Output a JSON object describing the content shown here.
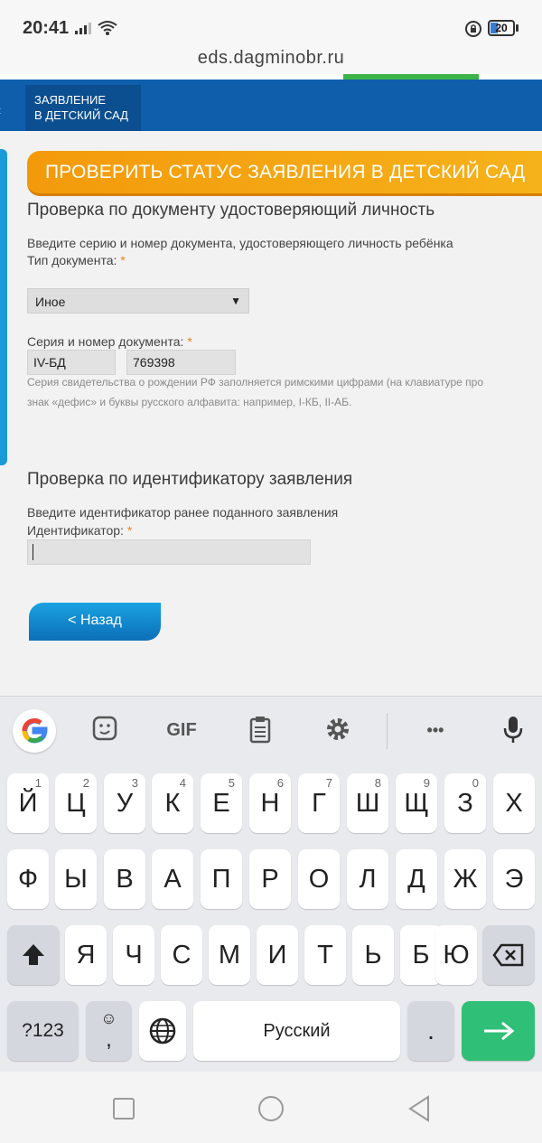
{
  "status_bar": {
    "time": "20:41",
    "battery": "20"
  },
  "browser": {
    "url": "eds.dagminobr.ru"
  },
  "site_header": {
    "menu_tab_line1": "ЗАЯВЛЕНИЕ",
    "menu_tab_line2": "В ДЕТСКИЙ САД"
  },
  "banner": {
    "title": "ПРОВЕРИТЬ СТАТУС ЗАЯВЛЕНИЯ В ДЕТСКИЙ САД"
  },
  "section_doc": {
    "heading": "Проверка по документу удостоверяющий личность",
    "instruction": "Введите серию и номер документа, удостоверяющего личность ребёнка",
    "doc_type_label": "Тип документа:",
    "required_mark": "*",
    "doc_type_value": "Иное",
    "series_label": "Серия и номер документа:",
    "series_value": "IV-БД",
    "number_value": "769398",
    "hint_line1": "Серия свидетельства о рождении РФ заполняется римскими цифрами (на клавиатуре про",
    "hint_line2": "знак «дефис» и буквы русского алфавита: например, I-КБ, II-АБ."
  },
  "section_id": {
    "heading": "Проверка по идентификатору заявления",
    "instruction": "Введите идентификатор ранее поданного заявления",
    "id_label": "Идентификатор:",
    "required_mark": "*",
    "id_value": ""
  },
  "back_button": {
    "label": "< Назад"
  },
  "keyboard": {
    "toolbar": {
      "gif_label": "GIF",
      "more_label": "•••"
    },
    "row1": [
      {
        "label": "Й",
        "hint": "1"
      },
      {
        "label": "Ц",
        "hint": "2"
      },
      {
        "label": "У",
        "hint": "3"
      },
      {
        "label": "К",
        "hint": "4"
      },
      {
        "label": "Е",
        "hint": "5"
      },
      {
        "label": "Н",
        "hint": "6"
      },
      {
        "label": "Г",
        "hint": "7"
      },
      {
        "label": "Ш",
        "hint": "8"
      },
      {
        "label": "Щ",
        "hint": "9"
      },
      {
        "label": "З",
        "hint": "0"
      },
      {
        "label": "Х",
        "hint": ""
      }
    ],
    "row2": [
      "Ф",
      "Ы",
      "В",
      "А",
      "П",
      "Р",
      "О",
      "Л",
      "Д",
      "Ж",
      "Э"
    ],
    "row3": [
      "Я",
      "Ч",
      "С",
      "М",
      "И",
      "Т",
      "Ь",
      "Б",
      "Ю"
    ],
    "numbers_key": "?123",
    "comma_key": ",",
    "space_label": "Русский",
    "period_key": "."
  },
  "colors": {
    "header_blue": "#0e5eac",
    "banner_orange": "#f39a0b",
    "button_blue": "#1aa2e2",
    "enter_green": "#2fbf77",
    "required_orange": "#e8821e"
  }
}
